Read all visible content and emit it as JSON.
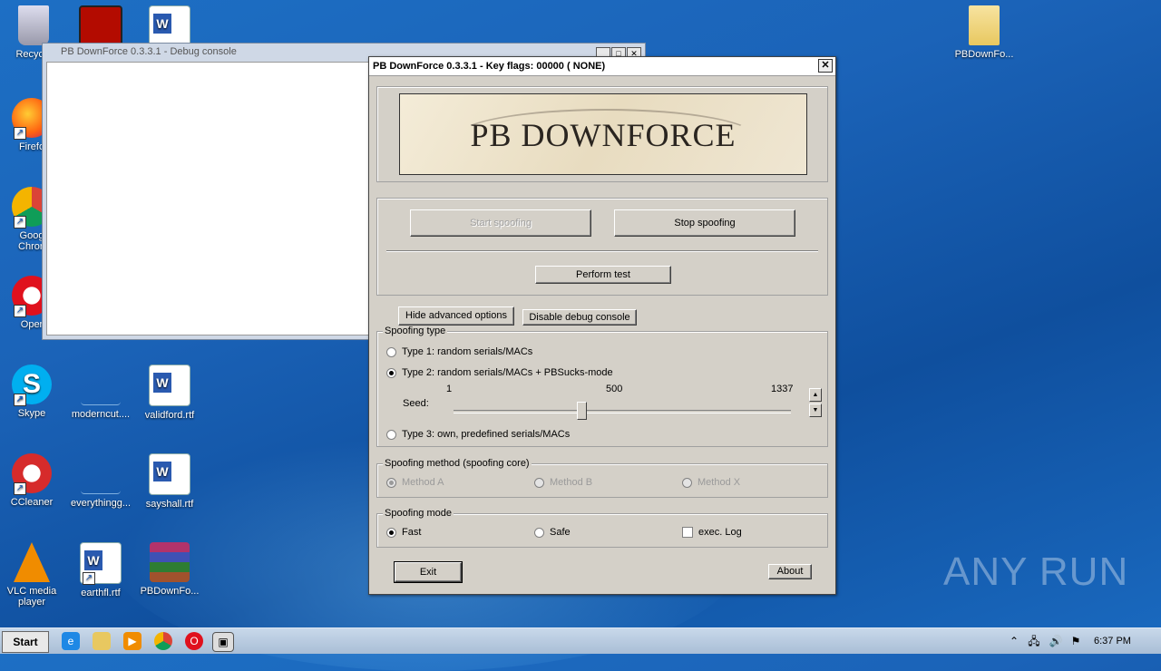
{
  "desktop": {
    "icons": [
      {
        "label": "Recycle",
        "icon": "recycle-bin-icon"
      },
      {
        "label": "Firefo",
        "icon": "firefox-icon"
      },
      {
        "label": "Goog",
        "label2": "Chron",
        "icon": "chrome-icon"
      },
      {
        "label": "Oper",
        "icon": "opera-icon"
      },
      {
        "label": "Skype",
        "icon": "skype-icon"
      },
      {
        "label": "CCleaner",
        "icon": "ccleaner-icon"
      },
      {
        "label": "VLC media",
        "label2": "player",
        "icon": "vlc-icon"
      },
      {
        "label": "moderncut....",
        "icon": "document-icon"
      },
      {
        "label": "everythingg...",
        "icon": "document-icon"
      },
      {
        "label": "earthfl.rtf",
        "icon": "word-icon"
      },
      {
        "label": "validford.rtf",
        "icon": "word-icon"
      },
      {
        "label": "sayshall.rtf",
        "icon": "word-icon"
      },
      {
        "label": "PBDownFo...",
        "icon": "winrar-icon"
      },
      {
        "label": "PBDownFo...",
        "icon": "folder-icon"
      }
    ],
    "watermark": "ANY RUN"
  },
  "console": {
    "title": "PB DownForce 0.3.3.1  -  Debug console"
  },
  "dialog": {
    "title": "PB DownForce 0.3.3.1  -  Key flags: 00000 ( NONE)",
    "close": "✕",
    "banner_text": "PB DOWNFORCE",
    "start_spoofing": "Start spoofing",
    "stop_spoofing": "Stop spoofing",
    "perform_test": "Perform test",
    "hide_advanced": "Hide advanced options",
    "disable_debug": "Disable debug console",
    "spoofing_type": {
      "legend": "Spoofing type",
      "type1": "Type 1: random serials/MACs",
      "type2": "Type 2: random serials/MACs + PBSucks-mode",
      "type3": "Type 3: own, predefined serials/MACs",
      "selected": "type2",
      "seed_label": "Seed:",
      "seed_min": "1",
      "seed_mid": "500",
      "seed_max": "1337",
      "seed_position": 0.38
    },
    "spoofing_method": {
      "legend": "Spoofing method (spoofing core)",
      "a": "Method A",
      "b": "Method B",
      "x": "Method X",
      "selected": "a"
    },
    "spoofing_mode": {
      "legend": "Spoofing mode",
      "fast": "Fast",
      "safe": "Safe",
      "exec_log": "exec. Log",
      "selected": "fast",
      "exec_log_checked": false
    },
    "exit": "Exit",
    "about": "About"
  },
  "taskbar": {
    "start": "Start",
    "clock": "6:37 PM"
  }
}
